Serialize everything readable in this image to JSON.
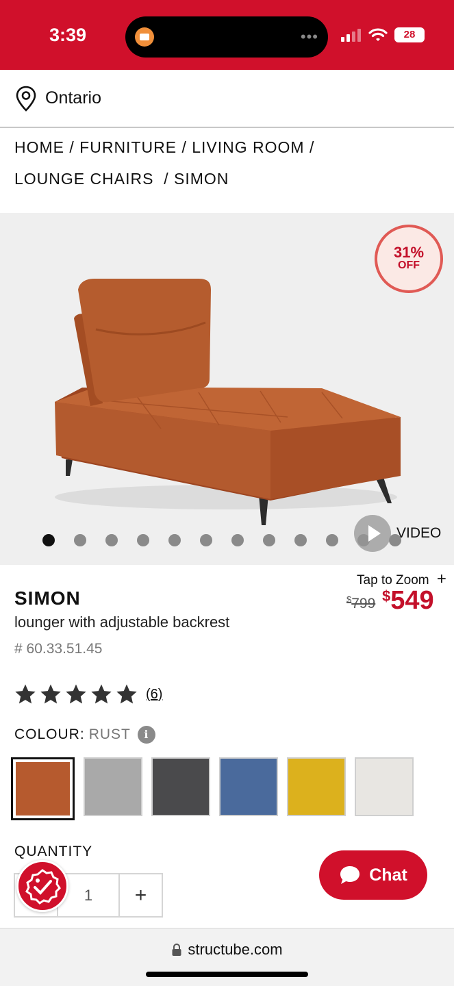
{
  "status_bar": {
    "time": "3:39",
    "battery": "28"
  },
  "location": {
    "label": "Ontario"
  },
  "breadcrumb": {
    "home": "HOME",
    "furniture": "FURNITURE",
    "living_room": "LIVING ROOM",
    "lounge_chairs": "LOUNGE CHAIRS",
    "current": "SIMON"
  },
  "gallery": {
    "discount_percent": "31%",
    "discount_label": "OFF",
    "video_label": "VIDEO",
    "total_images": 12,
    "active_index": 0
  },
  "product": {
    "tap_to_zoom": "Tap to Zoom",
    "name": "SIMON",
    "description": "lounger with adjustable backrest",
    "sku": "# 60.33.51.45",
    "price_old_symbol": "$",
    "price_old": "799",
    "price_new_symbol": "$",
    "price_new": "549",
    "rating": 5,
    "reviews": "(6)"
  },
  "colour": {
    "label": "COLOUR:",
    "selected": "RUST",
    "swatches": [
      "#b65a2e",
      "#a9a9a9",
      "#4a4a4c",
      "#4a6a9c",
      "#dcb11d",
      "#e8e6e2"
    ]
  },
  "quantity": {
    "label": "QUANTITY",
    "value": "1",
    "plus": "+"
  },
  "chat": {
    "label": "Chat"
  },
  "browser": {
    "url": "structube.com"
  },
  "colors": {
    "brand_red": "#d0102b",
    "price_red": "#c3102a"
  }
}
